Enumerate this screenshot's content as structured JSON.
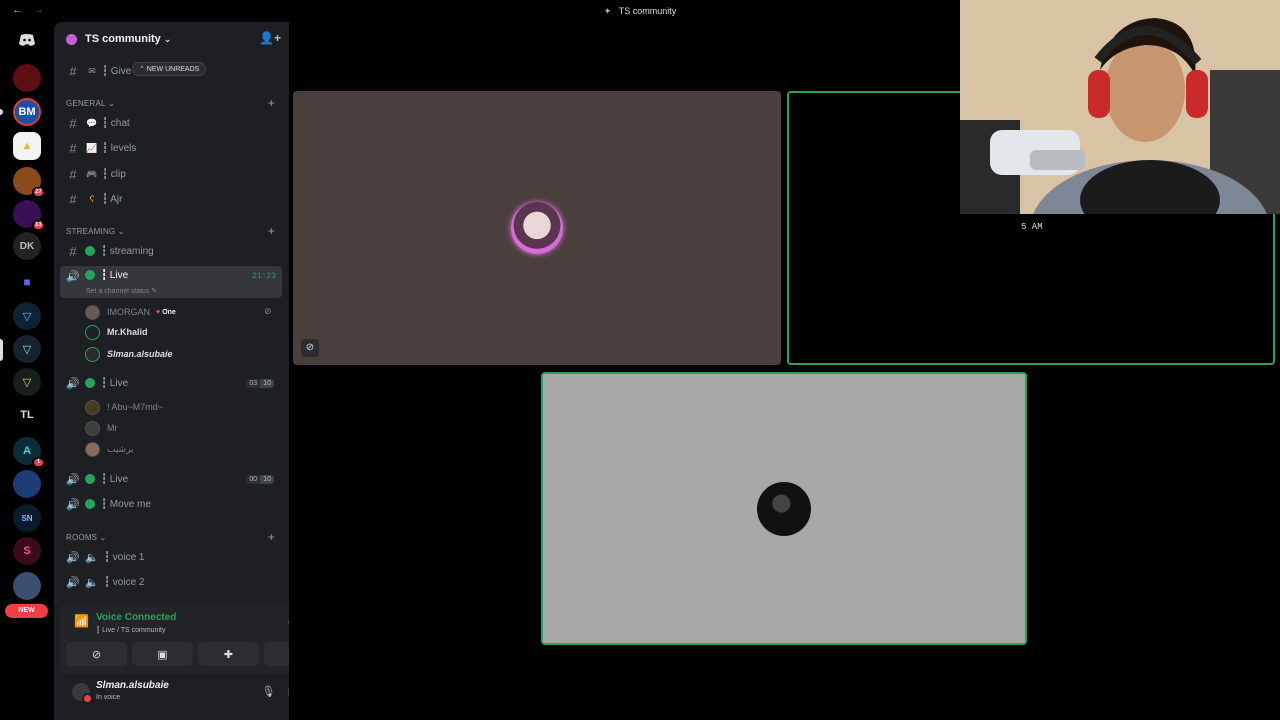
{
  "titlebar": {
    "title": "TS community",
    "back": "←",
    "forward": "→"
  },
  "rail": {
    "new_label": "NEW",
    "badges": {
      "b27": "27",
      "b13": "13",
      "b1": "1"
    },
    "tl_label": "TL"
  },
  "guild": {
    "name": "TS community"
  },
  "unread_pill": "⌃ NEW UNREADS",
  "channels": {
    "give": "┇ Give",
    "chat": "┇ chat",
    "levels": "┇ levels",
    "clip": "┇ clip",
    "ajr": "┇ Ajr",
    "streaming": "┇ streaming",
    "live1": "┇ Live",
    "live2": "┇ Live",
    "live3": "┇ Live",
    "moveme": "┇ Move me",
    "voice1": "┇ voice 1",
    "voice2": "┇ voice 2"
  },
  "categories": {
    "general": "GENERAL",
    "streaming": "STREAMING",
    "rooms": "ROOMS"
  },
  "live1": {
    "timer": "21:23",
    "status_hint": "Set a channel status ✎"
  },
  "live2": {
    "count_a": "03",
    "count_b": "10"
  },
  "live3": {
    "count_a": "00",
    "count_b": "10"
  },
  "voice_users_live1": [
    {
      "name": "IMORGAN",
      "tag": "One"
    },
    {
      "name": "Mr.Khalid"
    },
    {
      "name": "Slman.alsubaie"
    }
  ],
  "voice_users_live2": [
    {
      "name": "! Abu~M7md~"
    },
    {
      "name": "Mr"
    },
    {
      "name": "برشيب"
    }
  ],
  "voice_panel": {
    "title": "Voice Connected",
    "subtitle": "┇ Live / TS community"
  },
  "user": {
    "name": "Slman.alsubaie",
    "status": "In voice"
  },
  "stage": {
    "clock": "5 AM"
  },
  "colors": {
    "green": "#23a55a",
    "red": "#f23f43",
    "sidebar": "#1e1f22"
  }
}
